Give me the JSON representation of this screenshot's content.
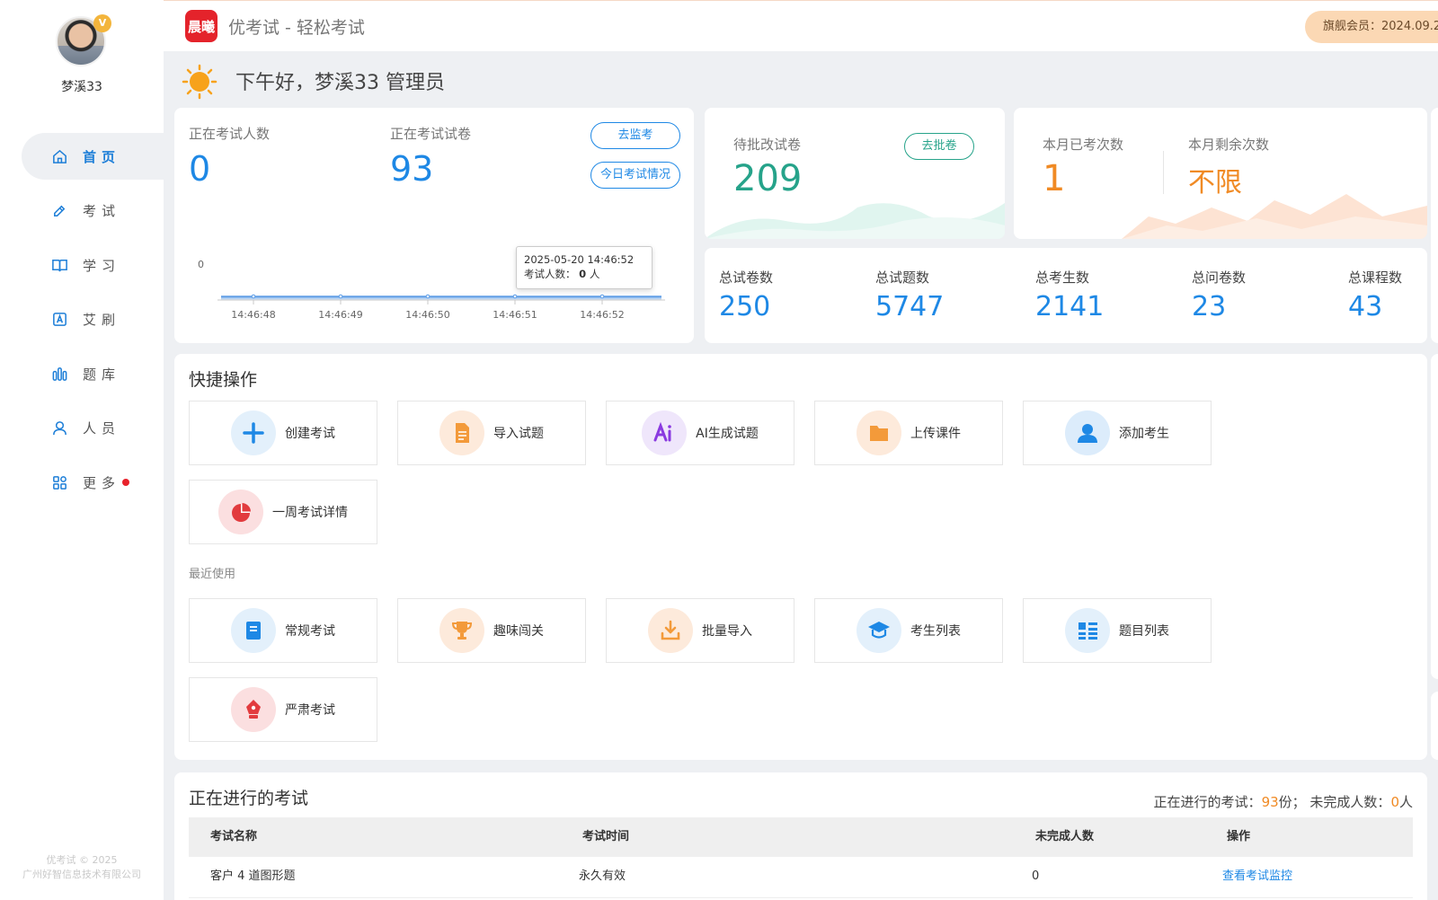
{
  "sidebar": {
    "username": "梦溪33",
    "vip_badge": "V",
    "items": [
      {
        "label": "首页",
        "icon": "home-icon"
      },
      {
        "label": "考试",
        "icon": "pencil-icon"
      },
      {
        "label": "学习",
        "icon": "book-icon"
      },
      {
        "label": "艾刷",
        "icon": "a-square-icon"
      },
      {
        "label": "题库",
        "icon": "bar-icon"
      },
      {
        "label": "人员",
        "icon": "user-icon"
      },
      {
        "label": "更多",
        "icon": "apps-icon"
      }
    ],
    "copyright_line1": "优考试 © 2025",
    "copyright_line2": "广州好智信息技术有限公司"
  },
  "header": {
    "logo_text": "晨曦",
    "title": "优考试 - 轻松考试",
    "member": "旗舰会员：2024.09.2"
  },
  "greeting": "下午好，梦溪33 管理员",
  "exam_card": {
    "label_people": "正在考试人数",
    "value_people": "0",
    "label_papers": "正在考试试卷",
    "value_papers": "93",
    "btn_monitor": "去监考",
    "btn_today": "今日考试情况",
    "tooltip_time": "2025-05-20 14:46:52",
    "tooltip_label": "考试人数：",
    "tooltip_value": "0",
    "tooltip_unit": "人"
  },
  "chart_data": {
    "type": "area",
    "x": [
      "14:46:48",
      "14:46:49",
      "14:46:50",
      "14:46:51",
      "14:46:52"
    ],
    "values": [
      0,
      0,
      0,
      0,
      0
    ],
    "y_tick": "0",
    "series_name": "考试人数",
    "color": "#4a90e2"
  },
  "pending": {
    "label": "待批改试卷",
    "value": "209",
    "btn": "去批卷"
  },
  "month": {
    "label_done": "本月已考次数",
    "value_done": "1",
    "label_left": "本月剩余次数",
    "value_left": "不限"
  },
  "totals": [
    {
      "label": "总试卷数",
      "value": "250"
    },
    {
      "label": "总试题数",
      "value": "5747"
    },
    {
      "label": "总考生数",
      "value": "2141"
    },
    {
      "label": "总问卷数",
      "value": "23"
    },
    {
      "label": "总课程数",
      "value": "43"
    }
  ],
  "quick": {
    "title": "快捷操作",
    "items": [
      {
        "label": "创建考试",
        "icon": "plus-icon"
      },
      {
        "label": "导入试题",
        "icon": "document-icon"
      },
      {
        "label": "AI生成试题",
        "icon": "ai-icon"
      },
      {
        "label": "上传课件",
        "icon": "folder-icon"
      },
      {
        "label": "添加考生",
        "icon": "person-icon"
      },
      {
        "label": "一周考试详情",
        "icon": "pie-icon"
      }
    ],
    "recent_label": "最近使用",
    "recent": [
      {
        "label": "常规考试",
        "icon": "exam-sheet-icon"
      },
      {
        "label": "趣味闯关",
        "icon": "trophy-icon"
      },
      {
        "label": "批量导入",
        "icon": "download-icon"
      },
      {
        "label": "考生列表",
        "icon": "graduation-cap-icon"
      },
      {
        "label": "题目列表",
        "icon": "list-icon"
      },
      {
        "label": "严肃考试",
        "icon": "pen-nib-icon"
      }
    ]
  },
  "running": {
    "title": "正在进行的考试",
    "summary_prefix": "正在进行的考试：",
    "summary_count": "93",
    "summary_mid": "份；  未完成人数：",
    "summary_unfinished": "0",
    "summary_suffix": "人",
    "columns": [
      "考试名称",
      "考试时间",
      "未完成人数",
      "操作"
    ],
    "rows": [
      {
        "name": "客户 4 道图形题",
        "time": "永久有效",
        "unfinished": "0",
        "action": "查看考试监控"
      }
    ]
  }
}
